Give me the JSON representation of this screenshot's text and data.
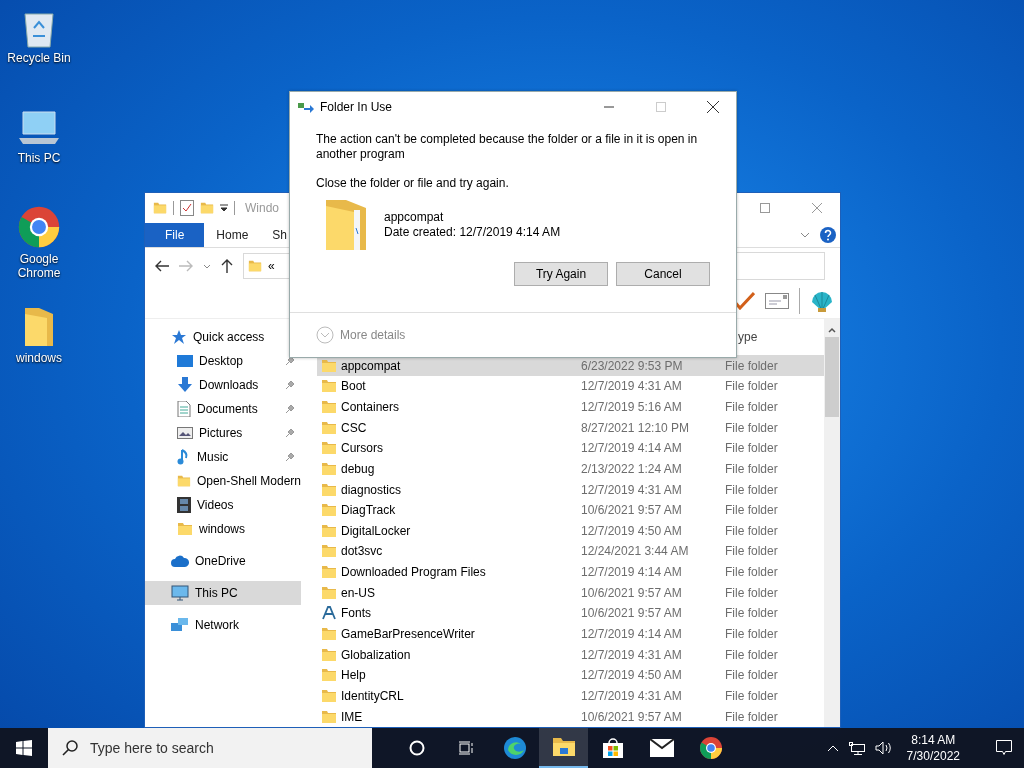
{
  "desktop_icons": [
    {
      "label": "Recycle Bin",
      "kind": "recycle"
    },
    {
      "label": "This PC",
      "kind": "pc"
    },
    {
      "label": "Google Chrome",
      "kind": "chrome"
    },
    {
      "label": "windows",
      "kind": "folder"
    }
  ],
  "explorer": {
    "title": "Windo",
    "ribbon_tabs": [
      {
        "label": "File",
        "selected": true
      },
      {
        "label": "Home",
        "selected": false
      },
      {
        "label": "Sh",
        "selected": false
      }
    ],
    "address": "«",
    "column_header": "ype",
    "nav": [
      {
        "label": "Quick access",
        "kind": "star",
        "selected": false,
        "children": [
          {
            "label": "Desktop",
            "kind": "desktop",
            "pinned": true,
            "selected": false
          },
          {
            "label": "Downloads",
            "kind": "download",
            "pinned": true,
            "selected": false
          },
          {
            "label": "Documents",
            "kind": "document",
            "pinned": true,
            "selected": false
          },
          {
            "label": "Pictures",
            "kind": "pictures",
            "pinned": true,
            "selected": false
          },
          {
            "label": "Music",
            "kind": "music",
            "pinned": true,
            "selected": false
          },
          {
            "label": "Open-Shell Modern",
            "kind": "folder",
            "pinned": false,
            "selected": false
          },
          {
            "label": "Videos",
            "kind": "videos",
            "pinned": false,
            "selected": false
          },
          {
            "label": "windows",
            "kind": "folder",
            "pinned": false,
            "selected": false
          }
        ]
      },
      {
        "label": "OneDrive",
        "kind": "cloud",
        "selected": false
      },
      {
        "label": "This PC",
        "kind": "pc",
        "selected": true
      },
      {
        "label": "Network",
        "kind": "network",
        "selected": false
      }
    ],
    "rows": [
      {
        "name": "appcompat",
        "date": "6/23/2022 9:53 PM",
        "type": "File folder",
        "kind": "folder",
        "selected": true
      },
      {
        "name": "Boot",
        "date": "12/7/2019 4:31 AM",
        "type": "File folder",
        "kind": "folder",
        "selected": false
      },
      {
        "name": "Containers",
        "date": "12/7/2019 5:16 AM",
        "type": "File folder",
        "kind": "folder",
        "selected": false
      },
      {
        "name": "CSC",
        "date": "8/27/2021 12:10 PM",
        "type": "File folder",
        "kind": "folder",
        "selected": false
      },
      {
        "name": "Cursors",
        "date": "12/7/2019 4:14 AM",
        "type": "File folder",
        "kind": "folder",
        "selected": false
      },
      {
        "name": "debug",
        "date": "2/13/2022 1:24 AM",
        "type": "File folder",
        "kind": "folder",
        "selected": false
      },
      {
        "name": "diagnostics",
        "date": "12/7/2019 4:31 AM",
        "type": "File folder",
        "kind": "folder",
        "selected": false
      },
      {
        "name": "DiagTrack",
        "date": "10/6/2021 9:57 AM",
        "type": "File folder",
        "kind": "folder",
        "selected": false
      },
      {
        "name": "DigitalLocker",
        "date": "12/7/2019 4:50 AM",
        "type": "File folder",
        "kind": "folder",
        "selected": false
      },
      {
        "name": "dot3svc",
        "date": "12/24/2021 3:44 AM",
        "type": "File folder",
        "kind": "folder",
        "selected": false
      },
      {
        "name": "Downloaded Program Files",
        "date": "12/7/2019 4:14 AM",
        "type": "File folder",
        "kind": "folder",
        "selected": false
      },
      {
        "name": "en-US",
        "date": "10/6/2021 9:57 AM",
        "type": "File folder",
        "kind": "folder",
        "selected": false
      },
      {
        "name": "Fonts",
        "date": "10/6/2021 9:57 AM",
        "type": "File folder",
        "kind": "fonts",
        "selected": false
      },
      {
        "name": "GameBarPresenceWriter",
        "date": "12/7/2019 4:14 AM",
        "type": "File folder",
        "kind": "folder",
        "selected": false
      },
      {
        "name": "Globalization",
        "date": "12/7/2019 4:31 AM",
        "type": "File folder",
        "kind": "folder",
        "selected": false
      },
      {
        "name": "Help",
        "date": "12/7/2019 4:50 AM",
        "type": "File folder",
        "kind": "folder",
        "selected": false
      },
      {
        "name": "IdentityCRL",
        "date": "12/7/2019 4:31 AM",
        "type": "File folder",
        "kind": "folder",
        "selected": false
      },
      {
        "name": "IME",
        "date": "10/6/2021 9:57 AM",
        "type": "File folder",
        "kind": "folder",
        "selected": false
      }
    ]
  },
  "dialog": {
    "title": "Folder In Use",
    "message": "The action can't be completed because the folder or a file in it is open in another program",
    "instruction": "Close the folder or file and try again.",
    "item_name": "appcompat",
    "item_detail": "Date created: 12/7/2019 4:14 AM",
    "buttons": [
      "Try Again",
      "Cancel"
    ],
    "more_details": "More details"
  },
  "taskbar": {
    "search_placeholder": "Type here to search",
    "apps": [
      {
        "kind": "cortana",
        "selected": false
      },
      {
        "kind": "taskview",
        "selected": false
      },
      {
        "kind": "edge",
        "selected": false
      },
      {
        "kind": "explorer",
        "selected": true
      },
      {
        "kind": "store",
        "selected": false
      },
      {
        "kind": "mail",
        "selected": false
      },
      {
        "kind": "chrome",
        "selected": false
      }
    ],
    "time": "8:14 AM",
    "date": "7/30/2022"
  }
}
